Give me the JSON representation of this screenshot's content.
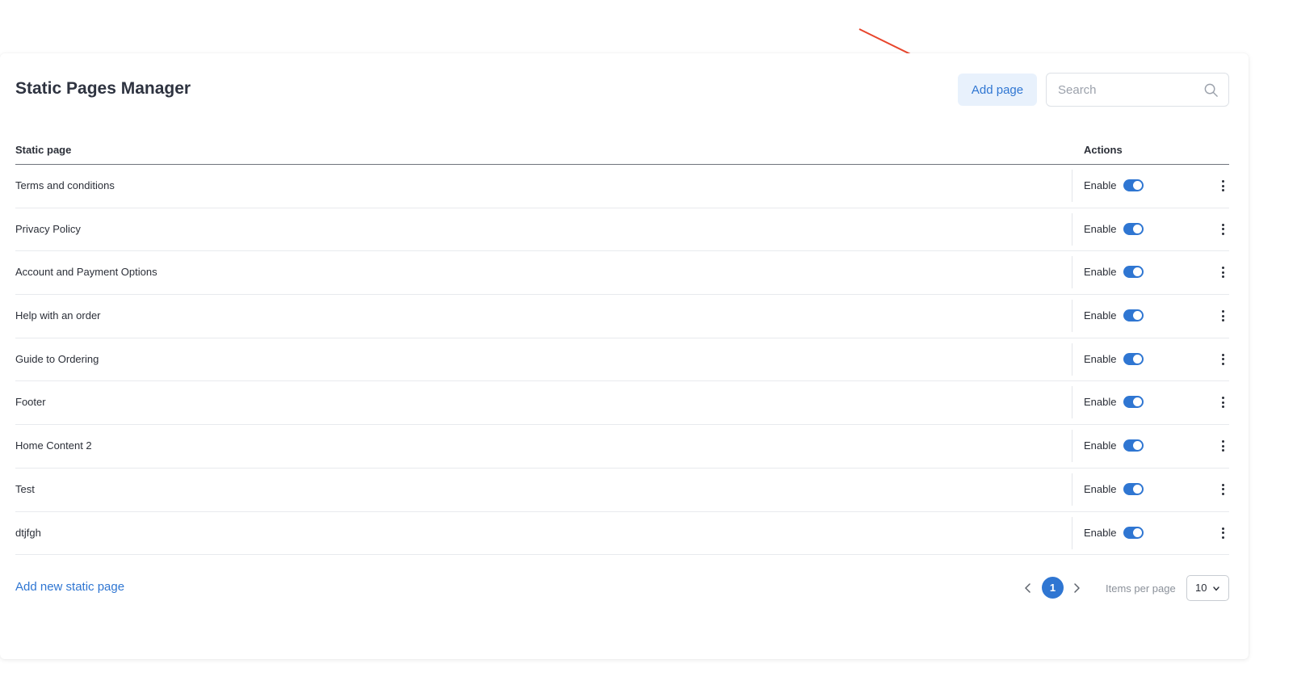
{
  "header": {
    "title": "Static Pages Manager",
    "add_button_label": "Add page",
    "search_placeholder": "Search"
  },
  "table": {
    "columns": [
      "Static page",
      "Actions"
    ],
    "rows": [
      {
        "name": "Terms and conditions",
        "status_label": "Enable",
        "enabled": true
      },
      {
        "name": "Privacy Policy",
        "status_label": "Enable",
        "enabled": true
      },
      {
        "name": "Account and Payment Options",
        "status_label": "Enable",
        "enabled": true
      },
      {
        "name": "Help with an order",
        "status_label": "Enable",
        "enabled": true
      },
      {
        "name": "Guide to Ordering",
        "status_label": "Enable",
        "enabled": true
      },
      {
        "name": "Footer",
        "status_label": "Enable",
        "enabled": true
      },
      {
        "name": "Home Content 2",
        "status_label": "Enable",
        "enabled": true
      },
      {
        "name": "Test",
        "status_label": "Enable",
        "enabled": true
      },
      {
        "name": "dtjfgh",
        "status_label": "Enable",
        "enabled": true
      }
    ]
  },
  "footer": {
    "add_link_label": "Add new static page",
    "current_page": "1",
    "items_per_page_label": "Items per page",
    "items_per_page_value": "10"
  },
  "icons": {
    "search": "search-icon",
    "prev": "chevron-left-icon",
    "next": "chevron-right-icon",
    "dropdown": "chevron-down-icon",
    "row_menu": "more-vertical-icon",
    "annotation": "red-arrow-annotation"
  },
  "colors": {
    "accent": "#2f76d2",
    "add_button_bg": "#e8f1fc",
    "annotation": "#e8452c"
  }
}
